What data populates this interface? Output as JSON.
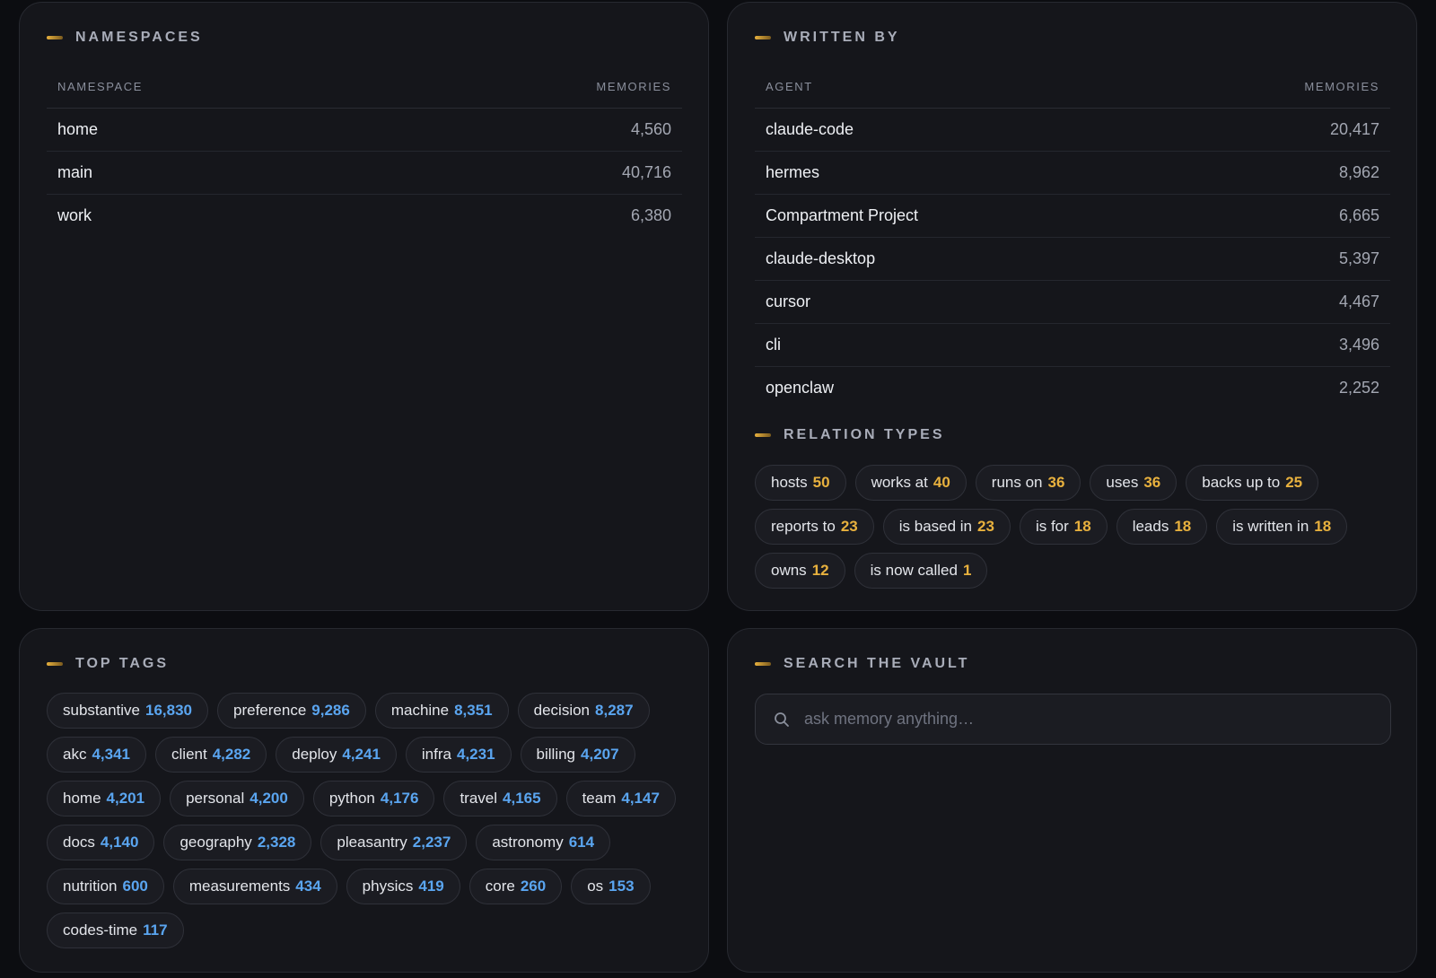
{
  "namespaces": {
    "title": "NAMESPACES",
    "columns": {
      "name": "NAMESPACE",
      "count": "MEMORIES"
    },
    "rows": [
      {
        "name": "home",
        "count": "4,560"
      },
      {
        "name": "main",
        "count": "40,716"
      },
      {
        "name": "work",
        "count": "6,380"
      }
    ]
  },
  "written_by": {
    "title": "WRITTEN BY",
    "columns": {
      "name": "AGENT",
      "count": "MEMORIES"
    },
    "rows": [
      {
        "name": "claude-code",
        "count": "20,417"
      },
      {
        "name": "hermes",
        "count": "8,962"
      },
      {
        "name": "Compartment Project",
        "count": "6,665"
      },
      {
        "name": "claude-desktop",
        "count": "5,397"
      },
      {
        "name": "cursor",
        "count": "4,467"
      },
      {
        "name": "cli",
        "count": "3,496"
      },
      {
        "name": "openclaw",
        "count": "2,252"
      }
    ]
  },
  "relation_types": {
    "title": "RELATION TYPES",
    "items": [
      {
        "label": "hosts",
        "count": "50"
      },
      {
        "label": "works at",
        "count": "40"
      },
      {
        "label": "runs on",
        "count": "36"
      },
      {
        "label": "uses",
        "count": "36"
      },
      {
        "label": "backs up to",
        "count": "25"
      },
      {
        "label": "reports to",
        "count": "23"
      },
      {
        "label": "is based in",
        "count": "23"
      },
      {
        "label": "is for",
        "count": "18"
      },
      {
        "label": "leads",
        "count": "18"
      },
      {
        "label": "is written in",
        "count": "18"
      },
      {
        "label": "owns",
        "count": "12"
      },
      {
        "label": "is now called",
        "count": "1"
      }
    ]
  },
  "top_tags": {
    "title": "TOP TAGS",
    "items": [
      {
        "label": "substantive",
        "count": "16,830"
      },
      {
        "label": "preference",
        "count": "9,286"
      },
      {
        "label": "machine",
        "count": "8,351"
      },
      {
        "label": "decision",
        "count": "8,287"
      },
      {
        "label": "akc",
        "count": "4,341"
      },
      {
        "label": "client",
        "count": "4,282"
      },
      {
        "label": "deploy",
        "count": "4,241"
      },
      {
        "label": "infra",
        "count": "4,231"
      },
      {
        "label": "billing",
        "count": "4,207"
      },
      {
        "label": "home",
        "count": "4,201"
      },
      {
        "label": "personal",
        "count": "4,200"
      },
      {
        "label": "python",
        "count": "4,176"
      },
      {
        "label": "travel",
        "count": "4,165"
      },
      {
        "label": "team",
        "count": "4,147"
      },
      {
        "label": "docs",
        "count": "4,140"
      },
      {
        "label": "geography",
        "count": "2,328"
      },
      {
        "label": "pleasantry",
        "count": "2,237"
      },
      {
        "label": "astronomy",
        "count": "614"
      },
      {
        "label": "nutrition",
        "count": "600"
      },
      {
        "label": "measurements",
        "count": "434"
      },
      {
        "label": "physics",
        "count": "419"
      },
      {
        "label": "core",
        "count": "260"
      },
      {
        "label": "os",
        "count": "153"
      },
      {
        "label": "codes-time",
        "count": "117"
      }
    ]
  },
  "search": {
    "title": "SEARCH THE VAULT",
    "placeholder": "ask memory anything…",
    "icon": "search-icon"
  },
  "colors": {
    "accent_gold": "#e8b13e",
    "accent_blue": "#5aa5f0",
    "panel_bg": "#15161b",
    "page_bg": "#0c0d11"
  }
}
